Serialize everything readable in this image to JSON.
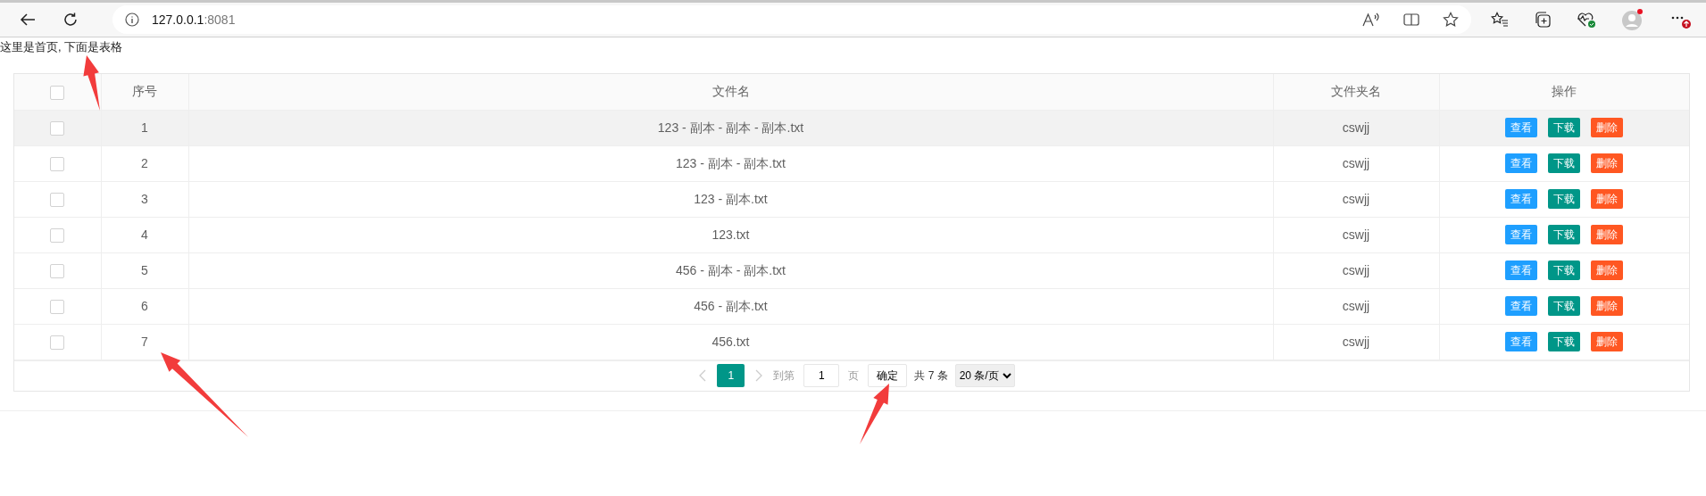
{
  "browser": {
    "url_host": "127.0.0.1",
    "url_port": ":8081"
  },
  "intro_text": "这里是首页, 下面是表格",
  "table": {
    "header_checked": false,
    "columns": [
      "序号",
      "文件名",
      "文件夹名",
      "操作"
    ],
    "rows": [
      {
        "checked": false,
        "hovered": true,
        "index": "1",
        "file_name": "123 - 副本 - 副本 - 副本.txt",
        "folder": "cswjj",
        "actions": [
          {
            "kind": "view",
            "label": "查看"
          },
          {
            "kind": "download",
            "label": "下载"
          },
          {
            "kind": "delete",
            "label": "删除"
          }
        ]
      },
      {
        "checked": false,
        "hovered": false,
        "index": "2",
        "file_name": "123 - 副本 - 副本.txt",
        "folder": "cswjj",
        "actions": [
          {
            "kind": "view",
            "label": "查看"
          },
          {
            "kind": "download",
            "label": "下载"
          },
          {
            "kind": "delete",
            "label": "删除"
          }
        ]
      },
      {
        "checked": false,
        "hovered": false,
        "index": "3",
        "file_name": "123 - 副本.txt",
        "folder": "cswjj",
        "actions": [
          {
            "kind": "view",
            "label": "查看"
          },
          {
            "kind": "download",
            "label": "下载"
          },
          {
            "kind": "delete",
            "label": "删除"
          }
        ]
      },
      {
        "checked": false,
        "hovered": false,
        "index": "4",
        "file_name": "123.txt",
        "folder": "cswjj",
        "actions": [
          {
            "kind": "view",
            "label": "查看"
          },
          {
            "kind": "download",
            "label": "下载"
          },
          {
            "kind": "delete",
            "label": "删除"
          }
        ]
      },
      {
        "checked": false,
        "hovered": false,
        "index": "5",
        "file_name": "456 - 副本 - 副本.txt",
        "folder": "cswjj",
        "actions": [
          {
            "kind": "view",
            "label": "查看"
          },
          {
            "kind": "download",
            "label": "下载"
          },
          {
            "kind": "delete",
            "label": "删除"
          }
        ]
      },
      {
        "checked": false,
        "hovered": false,
        "index": "6",
        "file_name": "456 - 副本.txt",
        "folder": "cswjj",
        "actions": [
          {
            "kind": "view",
            "label": "查看"
          },
          {
            "kind": "download",
            "label": "下载"
          },
          {
            "kind": "delete",
            "label": "删除"
          }
        ]
      },
      {
        "checked": false,
        "hovered": false,
        "index": "7",
        "file_name": "456.txt",
        "folder": "cswjj",
        "actions": [
          {
            "kind": "view",
            "label": "查看"
          },
          {
            "kind": "download",
            "label": "下载"
          },
          {
            "kind": "delete",
            "label": "删除"
          }
        ]
      }
    ]
  },
  "pagination": {
    "pages": [
      {
        "label": "1",
        "selected": true
      }
    ],
    "goto_label": "到第",
    "goto_value": "1",
    "page_suffix": "页",
    "confirm": "确定",
    "total": "共 7 条",
    "page_size": "20 条/页"
  }
}
